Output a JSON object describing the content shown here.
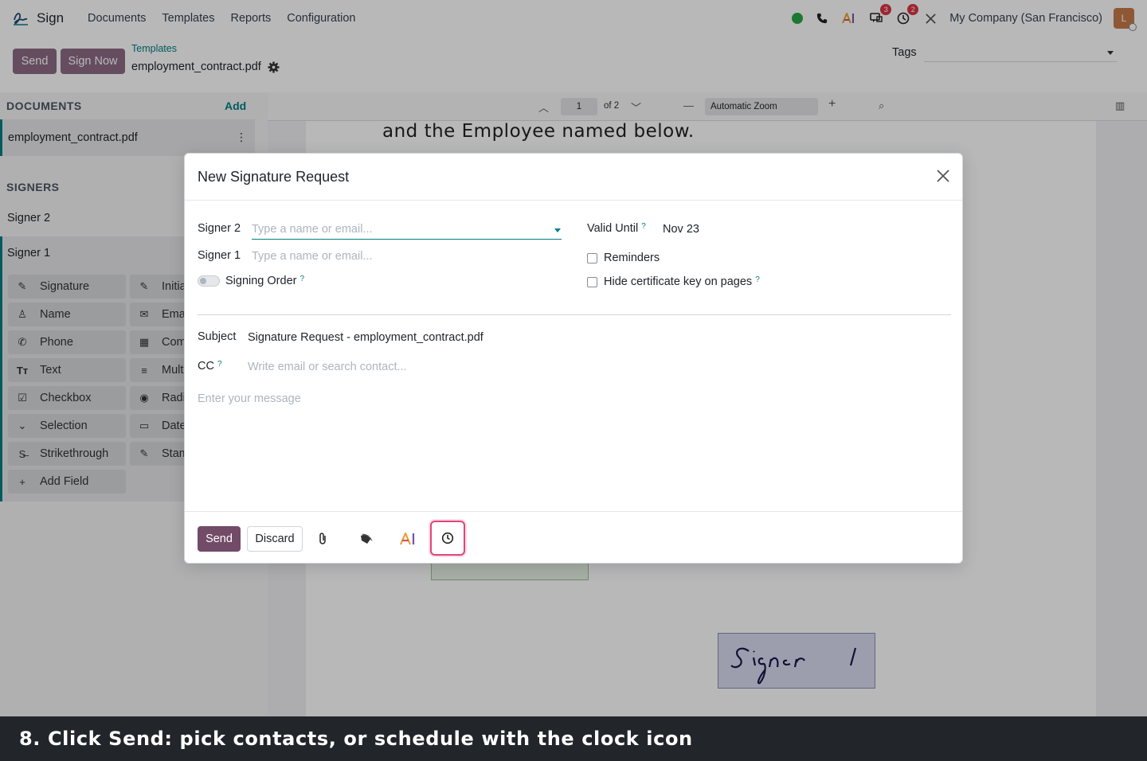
{
  "app": {
    "name": "Sign"
  },
  "nav": {
    "menu": [
      "Documents",
      "Templates",
      "Reports",
      "Configuration"
    ],
    "company": "My Company (San Francisco)",
    "avatar_initial": "L",
    "chat_badge": "3",
    "activity_badge": "2"
  },
  "control": {
    "send_label": "Send",
    "sign_now_label": "Sign Now",
    "breadcrumb": "Templates",
    "record_title": "employment_contract.pdf",
    "tags_label": "Tags"
  },
  "sidebar": {
    "documents_header": "DOCUMENTS",
    "add_label": "Add",
    "document_name": "employment_contract.pdf",
    "signers_header": "SIGNERS",
    "signer_2": "Signer 2",
    "signer_1": "Signer 1",
    "fields_left": [
      "Signature",
      "Name",
      "Phone",
      "Text",
      "Checkbox",
      "Selection",
      "Strikethrough",
      "Add Field"
    ],
    "fields_right": [
      "Initia",
      "Ema",
      "Com",
      "Multi",
      "Radi",
      "Date",
      "Stam"
    ]
  },
  "viewer": {
    "page": "1",
    "of_pages": "of 2",
    "zoom": "Automatic Zoom",
    "pdf_line": "and the Employee named below.",
    "signer_box": "Signer 1"
  },
  "modal": {
    "title": "New Signature Request",
    "signer2_label": "Signer 2",
    "signer2_placeholder": "Type a name or email...",
    "signer1_label": "Signer 1",
    "signer1_placeholder": "Type a name or email...",
    "signing_order_label": "Signing Order",
    "valid_until_label": "Valid Until",
    "valid_until_value": "Nov 23",
    "reminders_label": "Reminders",
    "hide_cert_label": "Hide certificate key on pages",
    "subject_label": "Subject",
    "subject_value": "Signature Request - employment_contract.pdf",
    "cc_label": "CC",
    "cc_placeholder": "Write email or search contact...",
    "message_placeholder": "Enter your message",
    "send_label": "Send",
    "discard_label": "Discard",
    "help_mark": "?"
  },
  "caption": "8. Click Send: pick contacts, or schedule with the clock icon",
  "colors": {
    "primary": "#714b67",
    "accent": "#017e84",
    "highlight": "#e0457b"
  }
}
